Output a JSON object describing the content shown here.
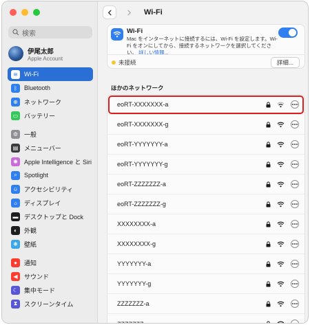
{
  "sidebar": {
    "search_placeholder": "検索",
    "account": {
      "name": "伊尾太郎",
      "subtitle": "Apple Account"
    },
    "items": [
      {
        "label": "Wi-Fi",
        "icon": "wifi-icon",
        "color": "#2f7ff0",
        "selected": true
      },
      {
        "label": "Bluetooth",
        "icon": "bluetooth-icon",
        "color": "#2f7ff0"
      },
      {
        "label": "ネットワーク",
        "icon": "globe-icon",
        "color": "#2f7ff0"
      },
      {
        "label": "バッテリー",
        "icon": "battery-icon",
        "color": "#34c759"
      },
      {
        "label": "一般",
        "icon": "gear-icon",
        "color": "#8e8e93",
        "gap_before": true
      },
      {
        "label": "メニューバー",
        "icon": "menubar-icon",
        "color": "#3a3a3c"
      },
      {
        "label": "Apple Intelligence と Siri",
        "icon": "siri-icon",
        "color": "#c86dd7"
      },
      {
        "label": "Spotlight",
        "icon": "magnifier-icon",
        "color": "#2f7ff0"
      },
      {
        "label": "アクセシビリティ",
        "icon": "accessibility-icon",
        "color": "#2f7ff0"
      },
      {
        "label": "ディスプレイ",
        "icon": "sun-icon",
        "color": "#2f7ff0"
      },
      {
        "label": "デスクトップと Dock",
        "icon": "dock-icon",
        "color": "#1d1d1f"
      },
      {
        "label": "外観",
        "icon": "appearance-icon",
        "color": "#1d1d1f"
      },
      {
        "label": "壁紙",
        "icon": "wallpaper-icon",
        "color": "#3aa6e8"
      },
      {
        "label": "通知",
        "icon": "bell-icon",
        "color": "#ff3b30",
        "gap_before": true
      },
      {
        "label": "サウンド",
        "icon": "speaker-icon",
        "color": "#ff3b30"
      },
      {
        "label": "集中モード",
        "icon": "moon-icon",
        "color": "#5856d6"
      },
      {
        "label": "スクリーンタイム",
        "icon": "hourglass-icon",
        "color": "#5856d6"
      }
    ]
  },
  "toolbar": {
    "title": "Wi-Fi"
  },
  "wifi": {
    "title": "Wi-Fi",
    "description": "Mac をインターネットに接続するには、Wi-Fi を設定します。Wi-Fi をオンにしてから、接続するネットワークを選択してください。",
    "link": "詳しい情報...",
    "enabled": true,
    "status": "未接続",
    "details_button": "詳細..."
  },
  "other_networks": {
    "title": "ほかのネットワーク",
    "items": [
      {
        "name": "eoRT-XXXXXXX-a",
        "highlighted": true
      },
      {
        "name": "eoRT-XXXXXXX-g"
      },
      {
        "name": "eoRT-YYYYYYY-a"
      },
      {
        "name": "eoRT-YYYYYYY-g"
      },
      {
        "name": "eoRT-ZZZZZZZ-a"
      },
      {
        "name": "eoRT-ZZZZZZZ-g"
      },
      {
        "name": "XXXXXXXX-a"
      },
      {
        "name": "XXXXXXXX-g"
      },
      {
        "name": "YYYYYYY-a"
      },
      {
        "name": "YYYYYYY-g"
      },
      {
        "name": "ZZZZZZZ-a"
      },
      {
        "name": "ZZZZZZZ-g"
      }
    ]
  }
}
